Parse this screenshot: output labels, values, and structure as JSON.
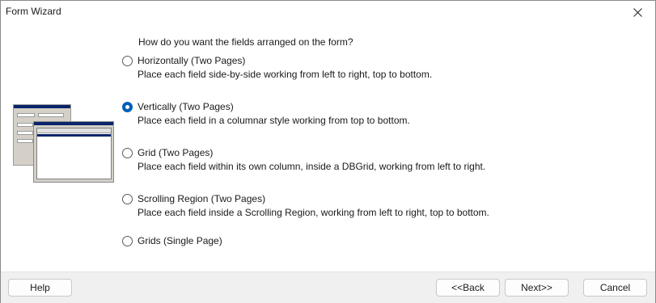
{
  "window": {
    "title": "Form Wizard"
  },
  "question": "How do you want the fields arranged on the form?",
  "options": [
    {
      "label": "Horizontally (Two Pages)",
      "description": "Place each field side-by-side working from left to right, top to bottom.",
      "checked": false
    },
    {
      "label": "Vertically (Two Pages)",
      "description": "Place each field in a columnar style working from top to bottom.",
      "checked": true
    },
    {
      "label": "Grid (Two Pages)",
      "description": "Place each field within its own column, inside a DBGrid, working from left to right.",
      "checked": false
    },
    {
      "label": "Scrolling Region (Two Pages)",
      "description": "Place each field inside a Scrolling Region, working from left to right, top to bottom.",
      "checked": false
    },
    {
      "label": "Grids (Single Page)",
      "description": "",
      "checked": false
    }
  ],
  "buttons": {
    "help": "Help",
    "back": "<<Back",
    "next": "Next>>",
    "cancel": "Cancel"
  },
  "colors": {
    "accent": "#005fb8",
    "footer_bg": "#f0f0f0"
  }
}
